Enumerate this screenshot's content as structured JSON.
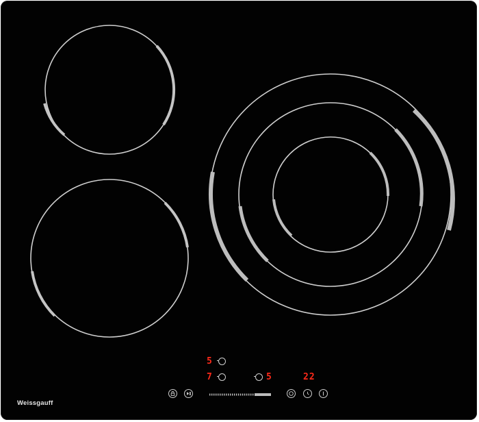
{
  "brand": {
    "name": "Weissgauff"
  },
  "colors": {
    "led": "#ff2a1a",
    "ring": "#d0d0d0",
    "glass": "#020202",
    "control": "#cfcfcf"
  },
  "zones": [
    {
      "id": "rear-left",
      "power_level": "5"
    },
    {
      "id": "front-left",
      "power_level": "7"
    },
    {
      "id": "right-triple",
      "power_level": "5"
    }
  ],
  "timer": {
    "display": "22"
  },
  "controls": {
    "lock_icon": "lock-icon",
    "pause_icon": "play-pause-icon",
    "boost_icon": "boost-icon",
    "timer_icon": "clock-icon",
    "power_icon": "power-icon",
    "slider_level_fraction": 0.72
  }
}
